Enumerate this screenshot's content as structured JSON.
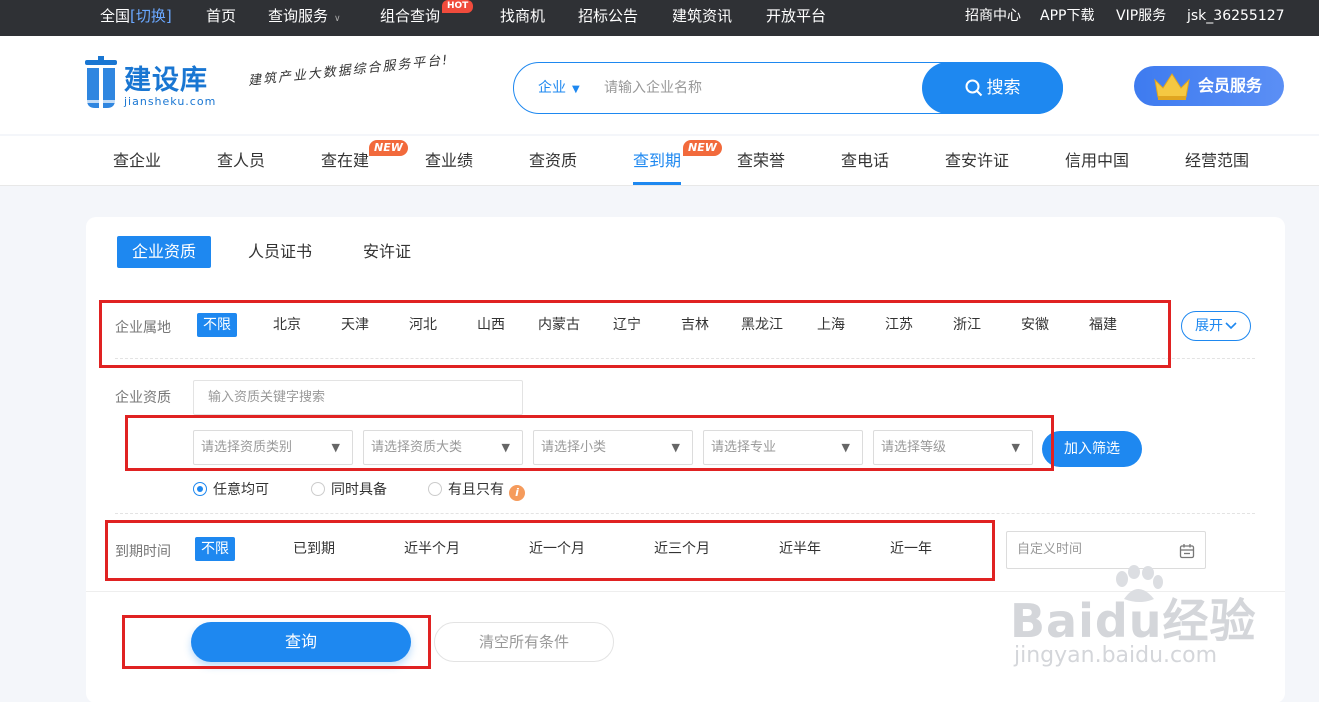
{
  "topbar": {
    "region": "全国",
    "switch": "[切换]",
    "links": [
      "首页",
      "查询服务",
      "组合查询",
      "找商机",
      "招标公告",
      "建筑资讯",
      "开放平台"
    ],
    "hot_badge": "HOT",
    "right_links": [
      "招商中心",
      "APP下载",
      "VIP服务",
      "jsk_36255127"
    ]
  },
  "header": {
    "logo_text": "建设库",
    "logo_sub": "jiansheku.com",
    "slogan": "建筑产业大数据综合服务平台!",
    "search_type": "企业",
    "search_placeholder": "请输入企业名称",
    "search_button": "搜索",
    "vip_button": "会员服务"
  },
  "nav": {
    "tabs": [
      "查企业",
      "查人员",
      "查在建",
      "查业绩",
      "查资质",
      "查到期",
      "查荣誉",
      "查电话",
      "查安许证",
      "信用中国",
      "经营范围"
    ],
    "new_badge": "NEW",
    "active": "查到期"
  },
  "subtabs": [
    "企业资质",
    "人员证书",
    "安许证"
  ],
  "filters": {
    "region_label": "企业属地",
    "region_options": [
      "不限",
      "北京",
      "天津",
      "河北",
      "山西",
      "内蒙古",
      "辽宁",
      "吉林",
      "黑龙江",
      "上海",
      "江苏",
      "浙江",
      "安徽",
      "福建"
    ],
    "expand": "展开",
    "qual_label": "企业资质",
    "qual_placeholder": "输入资质关键字搜索",
    "selects": [
      "请选择资质类别",
      "请选择资质大类",
      "请选择小类",
      "请选择专业",
      "请选择等级"
    ],
    "add_button": "加入筛选",
    "radios": [
      "任意均可",
      "同时具备",
      "有且只有"
    ],
    "info_glyph": "i",
    "expire_label": "到期时间",
    "expire_options": [
      "不限",
      "已到期",
      "近半个月",
      "近一个月",
      "近三个月",
      "近半年",
      "近一年"
    ],
    "custom_time": "自定义时间"
  },
  "actions": {
    "query": "查询",
    "clear": "清空所有条件"
  },
  "watermark": {
    "big": "Baidu经验",
    "small": "jingyan.baidu.com"
  },
  "colors": {
    "accent": "#1e88f0",
    "topbar_bg": "#2f3135",
    "highlight_box": "#e02222",
    "new_badge": "#f26a3c",
    "hot_badge": "#f04b3c"
  }
}
